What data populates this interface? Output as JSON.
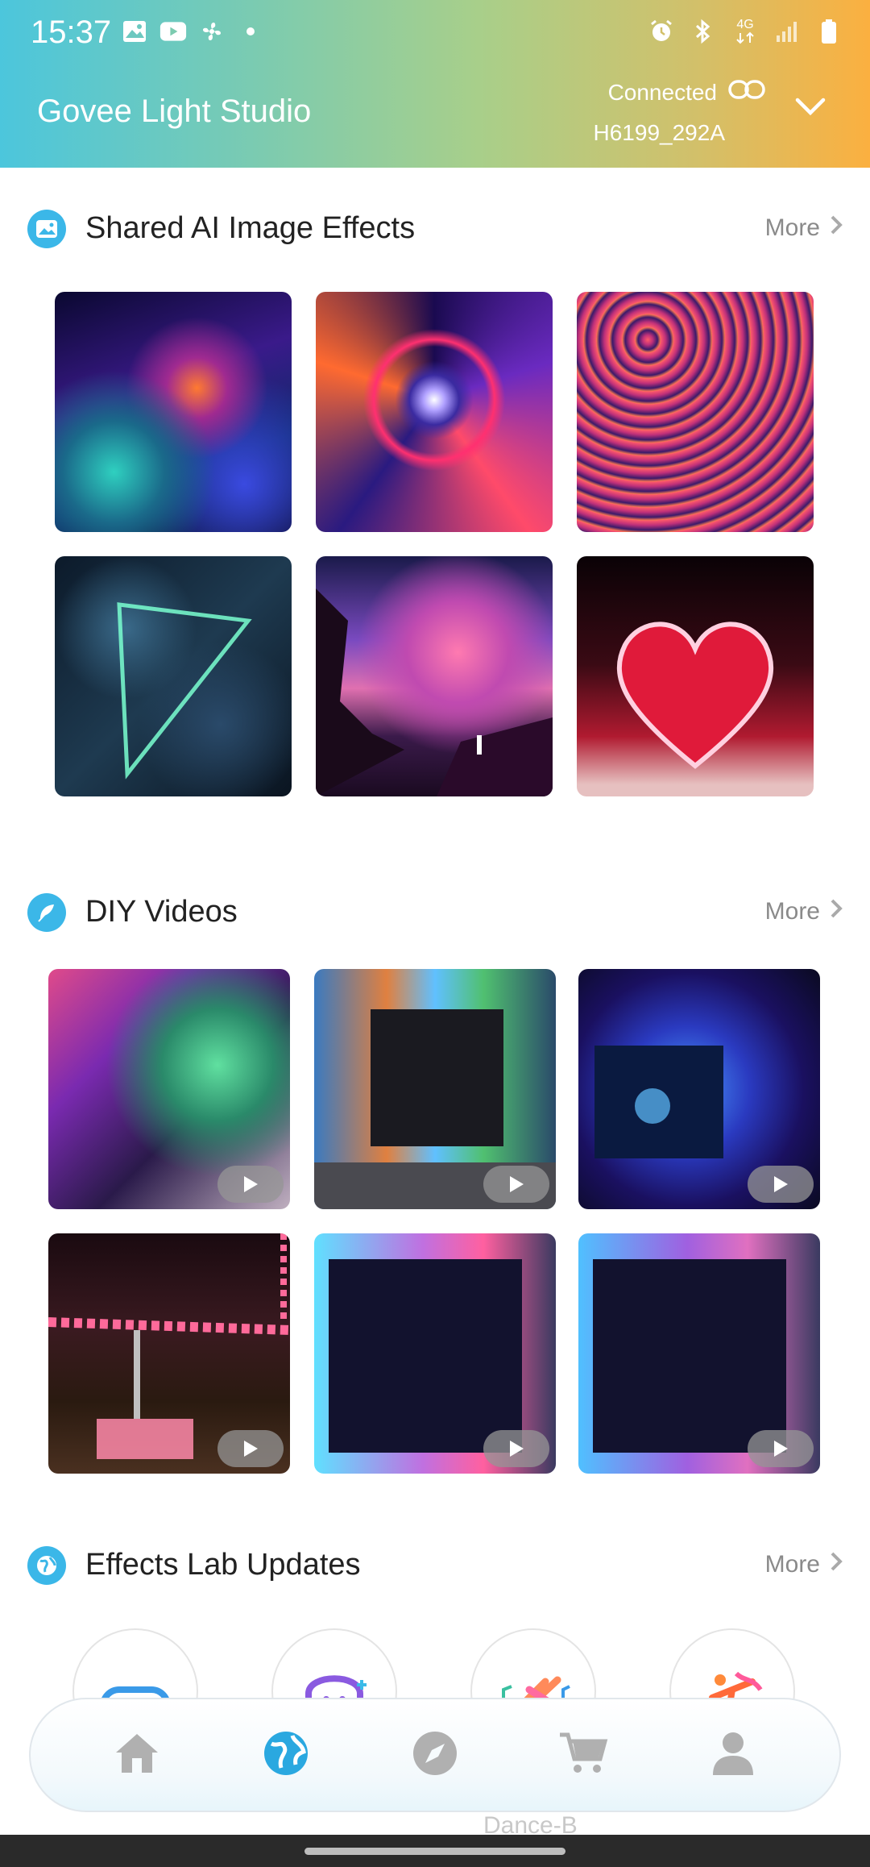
{
  "status_bar": {
    "time": "15:37",
    "left_icons": [
      "gallery-icon",
      "youtube-icon",
      "fan-icon",
      "dot-icon"
    ],
    "right_icons": [
      "alarm-icon",
      "bluetooth-icon",
      "4g-icon",
      "signal-icon",
      "battery-icon"
    ],
    "network_label": "4G"
  },
  "header": {
    "title": "Govee Light Studio",
    "connection_status": "Connected",
    "device_name": "H6199_292A",
    "gradient_colors": [
      "#4cc6dc",
      "#a8cf8a",
      "#fbb040"
    ]
  },
  "sections": {
    "ai_effects": {
      "title": "Shared AI Image Effects",
      "more_label": "More",
      "icon": "image-icon",
      "items": [
        {
          "name": "fractal-flowers-image"
        },
        {
          "name": "mandala-hexagram-image"
        },
        {
          "name": "neon-swirl-lines-image"
        },
        {
          "name": "neon-triangle-leaves-image"
        },
        {
          "name": "purple-landscape-image"
        },
        {
          "name": "neon-heart-image"
        }
      ]
    },
    "diy_videos": {
      "title": "DIY Videos",
      "more_label": "More",
      "icon": "feather-icon",
      "items": [
        {
          "name": "gaming-room-video"
        },
        {
          "name": "tv-rainbow-backlight-video"
        },
        {
          "name": "tv-blue-glow-video"
        },
        {
          "name": "pink-led-strip-video"
        },
        {
          "name": "tv-pink-cyan-video"
        },
        {
          "name": "tv-purple-cyan-video"
        }
      ]
    },
    "effects_lab": {
      "title": "Effects Lab Updates",
      "more_label": "More",
      "icon": "globe-icon",
      "items": [
        {
          "name": "game-controller-icon"
        },
        {
          "name": "ghost-face-icon"
        },
        {
          "name": "music-notes-icon"
        },
        {
          "name": "dancer-icon"
        }
      ],
      "partial_label": "Dance-B"
    }
  },
  "bottom_nav": {
    "items": [
      {
        "name": "home",
        "active": false
      },
      {
        "name": "explore-globe",
        "active": true
      },
      {
        "name": "discover-compass",
        "active": false
      },
      {
        "name": "shop-cart",
        "active": false
      },
      {
        "name": "profile",
        "active": false
      }
    ],
    "active_color": "#2aa8e0",
    "inactive_color": "#b0b0b0"
  }
}
